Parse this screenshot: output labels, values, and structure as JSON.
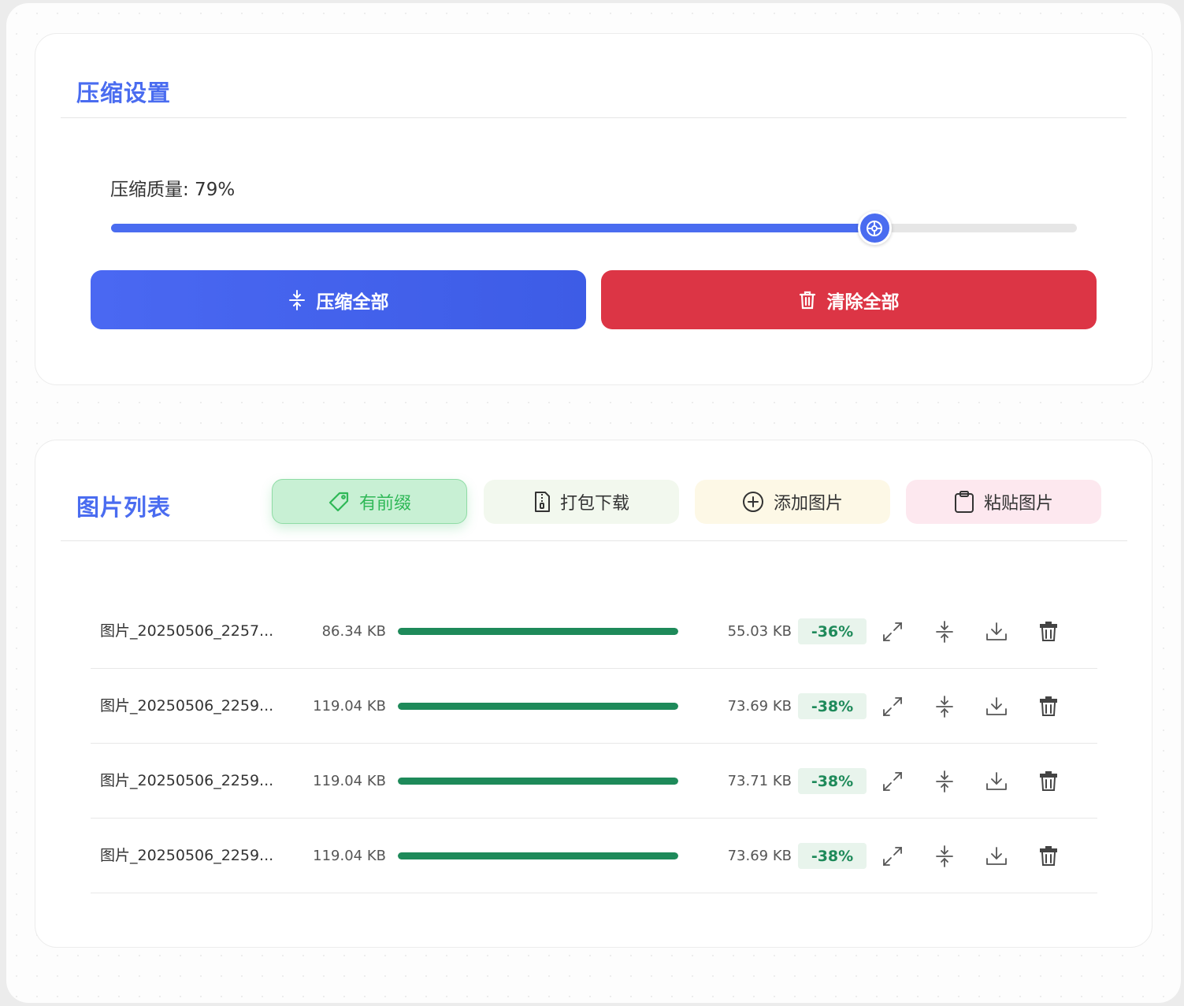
{
  "settings": {
    "title": "压缩设置",
    "quality_label": "压缩质量: 79%",
    "quality": 79,
    "compress_all_label": "压缩全部",
    "clear_all_label": "清除全部"
  },
  "list": {
    "title": "图片列表",
    "buttons": {
      "prefix": "有前缀",
      "zip_download": "打包下载",
      "add_image": "添加图片",
      "paste_image": "粘贴图片"
    },
    "rows": [
      {
        "name": "图片_20250506_2257...",
        "original": "86.34 KB",
        "progress": 100,
        "compressed": "55.03 KB",
        "ratio": "-36%"
      },
      {
        "name": "图片_20250506_2259...",
        "original": "119.04 KB",
        "progress": 100,
        "compressed": "73.69 KB",
        "ratio": "-38%"
      },
      {
        "name": "图片_20250506_2259...",
        "original": "119.04 KB",
        "progress": 100,
        "compressed": "73.71 KB",
        "ratio": "-38%"
      },
      {
        "name": "图片_20250506_2259...",
        "original": "119.04 KB",
        "progress": 100,
        "compressed": "73.69 KB",
        "ratio": "-38%"
      }
    ]
  },
  "colors": {
    "accent": "#4a6cf0",
    "danger": "#dc3545",
    "success": "#1e8a5a"
  },
  "icons": {
    "compress": "compress-arrows-icon",
    "clear": "trash-icon",
    "prefix": "tag-icon",
    "zip": "zip-file-icon",
    "add": "plus-circle-icon",
    "paste": "clipboard-icon",
    "row_preview": "expand-icon",
    "row_compress": "compress-arrows-icon",
    "row_download": "download-icon",
    "row_delete": "trash-icon"
  }
}
